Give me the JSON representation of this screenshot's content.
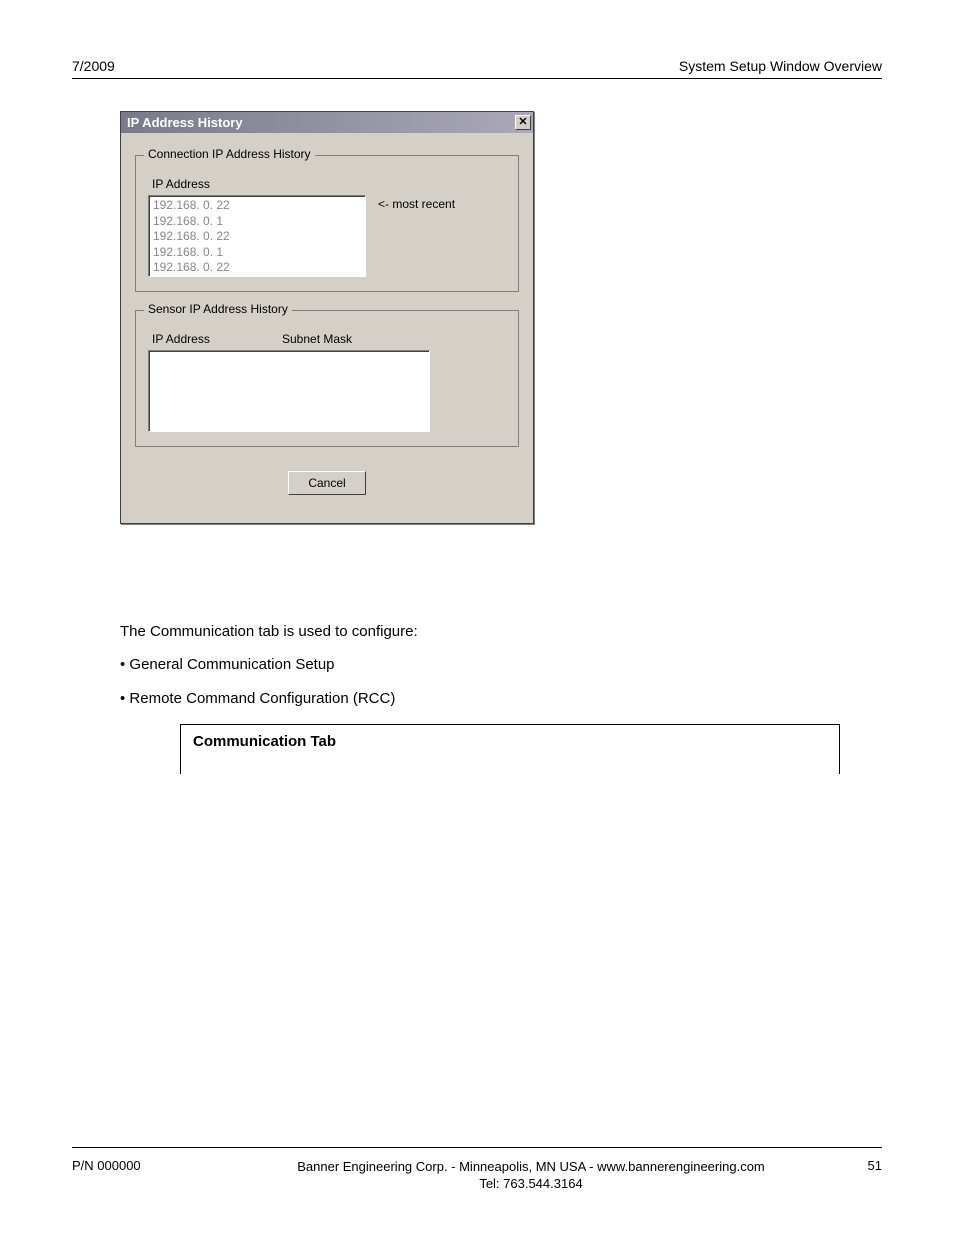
{
  "header": {
    "left": "7/2009",
    "right": "System Setup Window Overview"
  },
  "dialog": {
    "title": "IP Address History",
    "group1": {
      "legend": "Connection IP Address History",
      "col1": "IP Address",
      "items": [
        "192.168. 0. 22",
        "192.168. 0. 1",
        "192.168. 0. 22",
        "192.168. 0. 1",
        "192.168. 0. 22"
      ],
      "recent": "<- most recent"
    },
    "group2": {
      "legend": "Sensor IP Address History",
      "col1": "IP Address",
      "col2": "Subnet Mask"
    },
    "cancel": "Cancel"
  },
  "body": {
    "intro": "The Communication tab is used to configure:",
    "b1": "• General Communication Setup",
    "b2": "• Remote Command Configuration (RCC)",
    "comm_title": "Communication Tab"
  },
  "footer": {
    "left": "P/N 000000",
    "center1": "Banner Engineering Corp. - Minneapolis, MN USA - www.bannerengineering.com",
    "center2": "Tel: 763.544.3164",
    "page": "51"
  }
}
